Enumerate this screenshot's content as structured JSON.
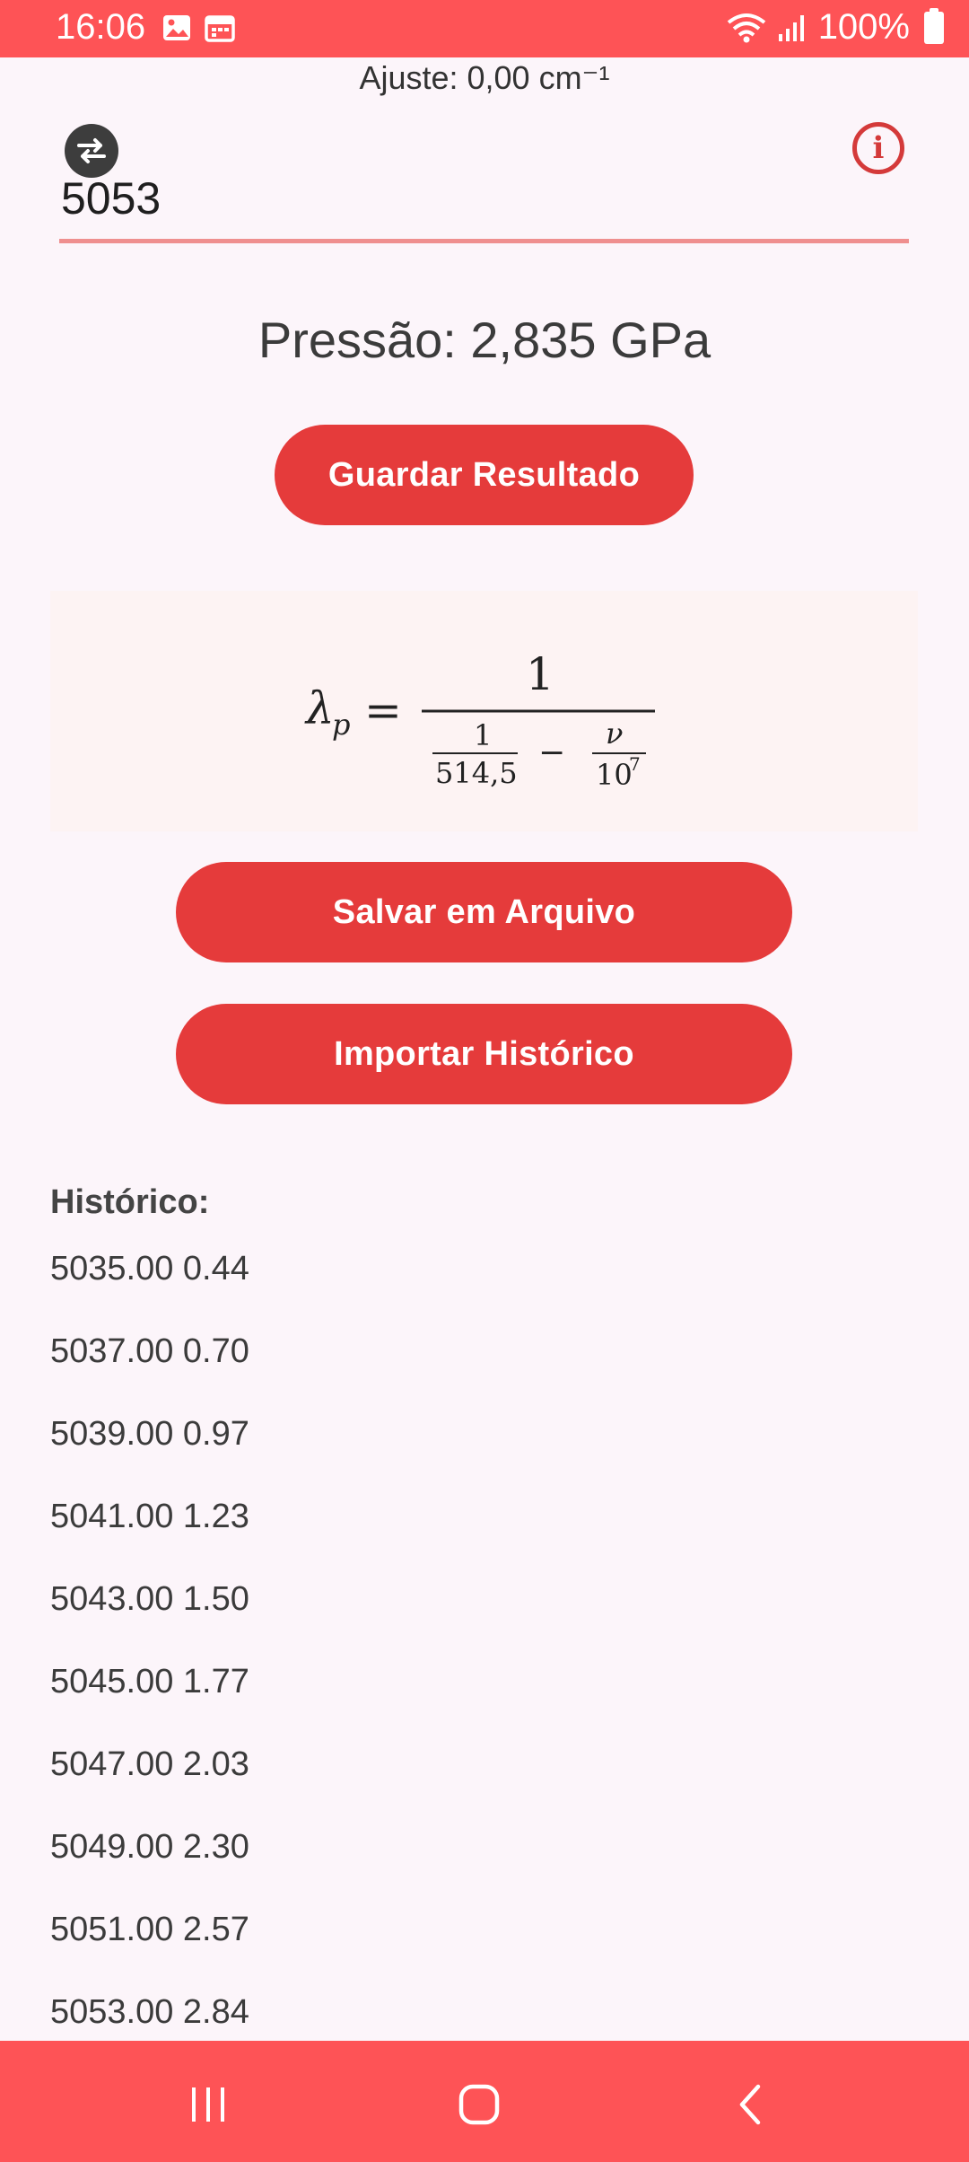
{
  "status_bar": {
    "time": "16:06",
    "battery": "100%",
    "icons": [
      "gallery-icon",
      "calendar-icon",
      "wifi-icon",
      "signal-icon",
      "battery-icon"
    ]
  },
  "ajuste_label": "Ajuste: 0,00 cm⁻¹",
  "input": {
    "value": "5053"
  },
  "pressure_label": "Pressão: 2,835 GPa",
  "buttons": {
    "guardar": "Guardar Resultado",
    "salvar": "Salvar em Arquivo",
    "importar": "Importar Histórico"
  },
  "formula": {
    "lhs_symbol": "λ",
    "lhs_sub": "p",
    "equals": "=",
    "numerator": "1",
    "inner1_num": "1",
    "inner1_den": "514,5",
    "minus": "−",
    "inner2_num": "ν",
    "inner2_den_base": "10",
    "inner2_den_exp": "7"
  },
  "history": {
    "title": "Histórico:",
    "items": [
      "5035.00 0.44",
      "5037.00 0.70",
      "5039.00 0.97",
      "5041.00 1.23",
      "5043.00 1.50",
      "5045.00 1.77",
      "5047.00 2.03",
      "5049.00 2.30",
      "5051.00 2.57",
      "5053.00 2.84"
    ]
  },
  "colors": {
    "accent": "#fe5356",
    "button": "#e53b3b",
    "background": "#fcf5fa"
  }
}
